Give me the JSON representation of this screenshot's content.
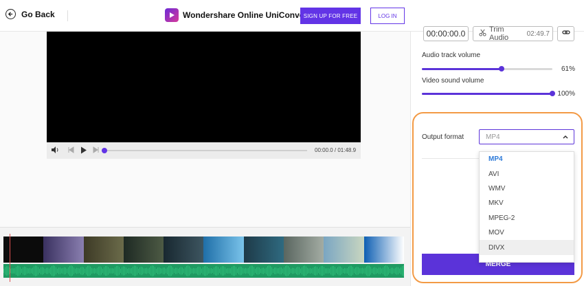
{
  "header": {
    "go_back": "Go Back",
    "brand": "Wondershare Online UniConverter",
    "signup": "SIGN UP FOR FREE",
    "login": "LOG IN"
  },
  "player": {
    "time": "00:00.0 / 01:48.9",
    "progress": 0.0
  },
  "trim": {
    "start_time": "00:00:00.0",
    "label": "Trim Audio",
    "duration": "02:49.7"
  },
  "audio_volume": {
    "label": "Audio track volume",
    "value": "61%",
    "level": 0.61
  },
  "video_volume": {
    "label": "Video sound volume",
    "value": "100%",
    "level": 1.0
  },
  "output": {
    "label": "Output format",
    "placeholder": "MP4",
    "options": [
      "MP4",
      "AVI",
      "WMV",
      "MKV",
      "MPEG-2",
      "MOV",
      "DIVX"
    ],
    "selected": "MP4",
    "hovered": "DIVX"
  },
  "merge": "MERGE",
  "colors": {
    "accent": "#6234e6",
    "highlight": "#f39a45",
    "audio_wave": "#2fbf7a"
  },
  "icons": {
    "back": "arrow-left-circle-icon",
    "trim": "scissors-icon",
    "link": "link-icon",
    "volume": "speaker-icon",
    "play": "play-icon"
  }
}
